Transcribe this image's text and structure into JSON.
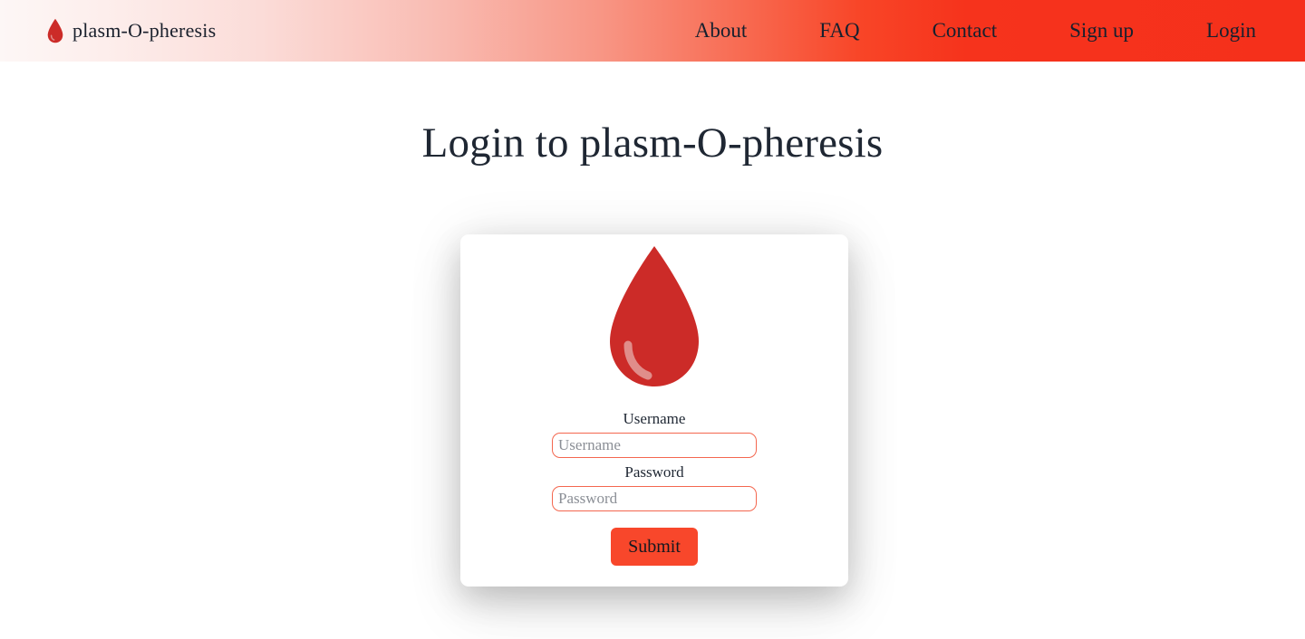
{
  "navbar": {
    "brand": {
      "icon": "blood-drop-icon",
      "label": "plasm-O-pheresis"
    },
    "links": [
      {
        "label": "About"
      },
      {
        "label": "FAQ"
      },
      {
        "label": "Contact"
      },
      {
        "label": "Sign up"
      },
      {
        "label": "Login"
      }
    ],
    "gradient_from": "#fdf7f6",
    "gradient_to": "#f5301b"
  },
  "main": {
    "page_title": "Login to plasm-O-pheresis",
    "card": {
      "logo_icon": "blood-drop-icon",
      "logo_color": "#cc2b28",
      "logo_highlight_color": "#e08d8a",
      "fields": [
        {
          "name": "username",
          "label": "Username",
          "placeholder": "Username",
          "value": "",
          "type": "text"
        },
        {
          "name": "password",
          "label": "Password",
          "placeholder": "Password",
          "value": "",
          "type": "password"
        }
      ],
      "submit_label": "Submit",
      "submit_color": "#f8472b",
      "input_border_color": "#f4674f"
    }
  }
}
